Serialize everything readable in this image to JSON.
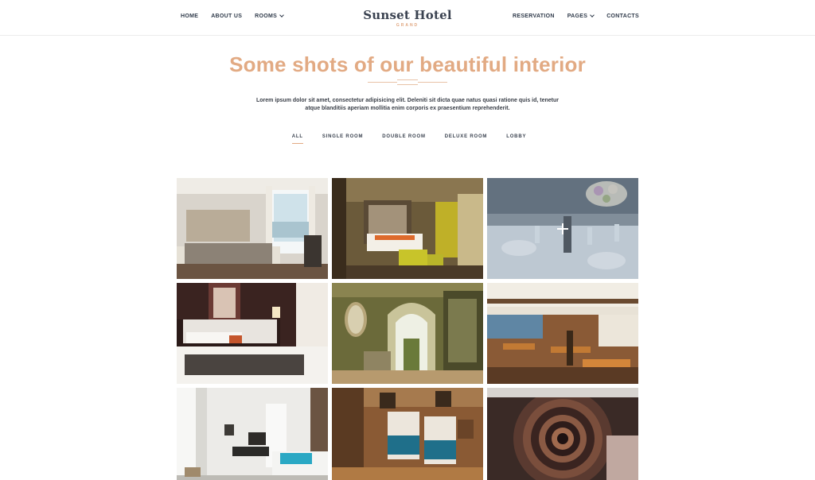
{
  "header": {
    "nav_left": [
      {
        "label": "HOME",
        "dropdown": false
      },
      {
        "label": "ABOUT US",
        "dropdown": false
      },
      {
        "label": "ROOMS",
        "dropdown": true
      }
    ],
    "logo": {
      "title": "Sunset Hotel",
      "subtitle": "GRAND"
    },
    "nav_right": [
      {
        "label": "RESERVATION",
        "dropdown": false
      },
      {
        "label": "PAGES",
        "dropdown": true
      },
      {
        "label": "CONTACTS",
        "dropdown": false
      }
    ]
  },
  "section": {
    "heading": "Some shots of our beautiful interior",
    "intro": "Lorem ipsum dolor sit amet, consectetur adipisicing elit. Deleniti sit dicta quae natus quasi ratione quis id, tenetur atque blanditiis aperiam mollitia enim corporis ex praesentium reprehenderit."
  },
  "filters": {
    "active": "ALL",
    "items": [
      "ALL",
      "SINGLE ROOM",
      "DOUBLE ROOM",
      "DELUXE ROOM",
      "LOBBY"
    ]
  },
  "gallery": {
    "items": [
      {
        "name": "bright-bedroom-photo"
      },
      {
        "name": "modern-room-photo"
      },
      {
        "name": "dining-table-photo",
        "hovered": true
      },
      {
        "name": "dark-bedroom-photo"
      },
      {
        "name": "lobby-arch-photo"
      },
      {
        "name": "restaurant-photo"
      },
      {
        "name": "white-suite-photo"
      },
      {
        "name": "twin-room-photo"
      },
      {
        "name": "spiral-staircase-photo"
      }
    ]
  },
  "colors": {
    "accent": "#e2aa83",
    "nav_text": "#2f3a4a"
  }
}
